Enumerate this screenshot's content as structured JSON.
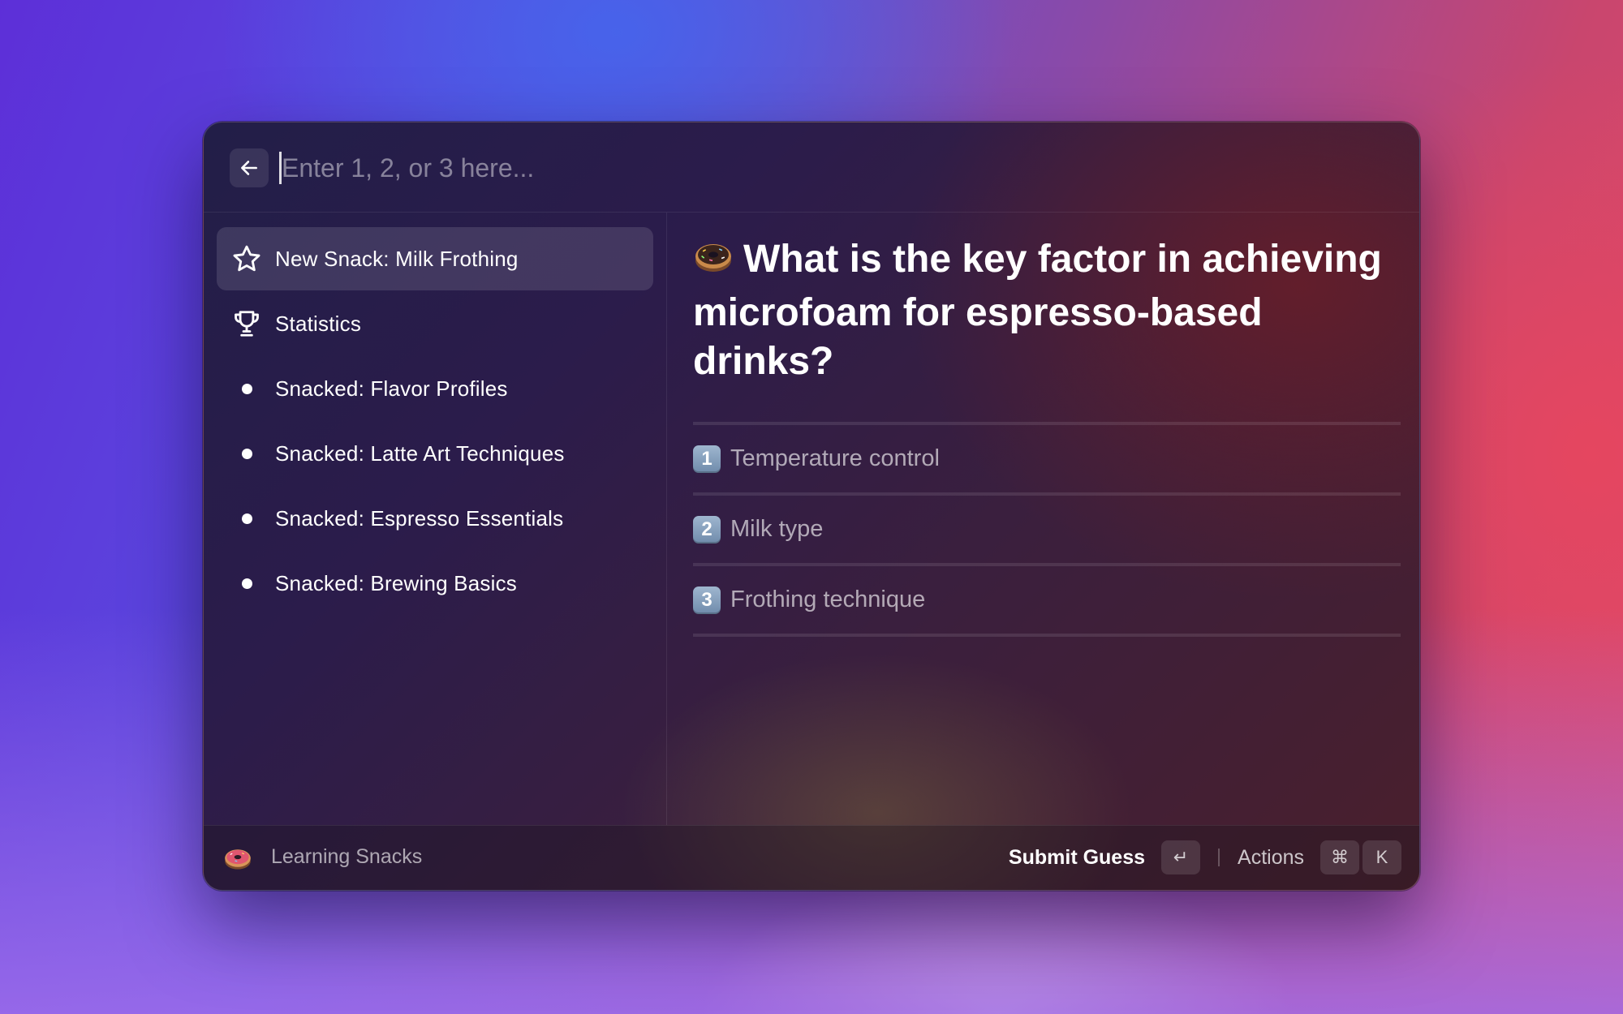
{
  "search": {
    "placeholder": "Enter 1, 2, or 3 here...",
    "value": ""
  },
  "sidebar": {
    "items": [
      {
        "icon": "star-icon",
        "label": "New Snack: Milk Frothing",
        "selected": true
      },
      {
        "icon": "trophy-icon",
        "label": "Statistics"
      },
      {
        "icon": "dot-icon",
        "label": "Snacked: Flavor Profiles"
      },
      {
        "icon": "dot-icon",
        "label": "Snacked: Latte Art Techniques"
      },
      {
        "icon": "dot-icon",
        "label": "Snacked: Espresso Essentials"
      },
      {
        "icon": "dot-icon",
        "label": "Snacked: Brewing Basics"
      }
    ]
  },
  "detail": {
    "question_icon": "donut-icon",
    "question": "What is the key factor in achieving microfoam for espresso-based drinks?",
    "answers": [
      {
        "key": "1",
        "label": "Temperature control"
      },
      {
        "key": "2",
        "label": "Milk type"
      },
      {
        "key": "3",
        "label": "Frothing technique"
      }
    ]
  },
  "footer": {
    "extension_icon": "donut-icon",
    "extension_name": "Learning Snacks",
    "primary_action": "Submit Guess",
    "primary_shortcut": "↵",
    "secondary_action": "Actions",
    "secondary_shortcut": [
      "⌘",
      "K"
    ]
  },
  "colors": {
    "keycap": "#7f99b8",
    "selected_row": "rgba(255,255,255,0.12)",
    "text": "#ffffff"
  }
}
